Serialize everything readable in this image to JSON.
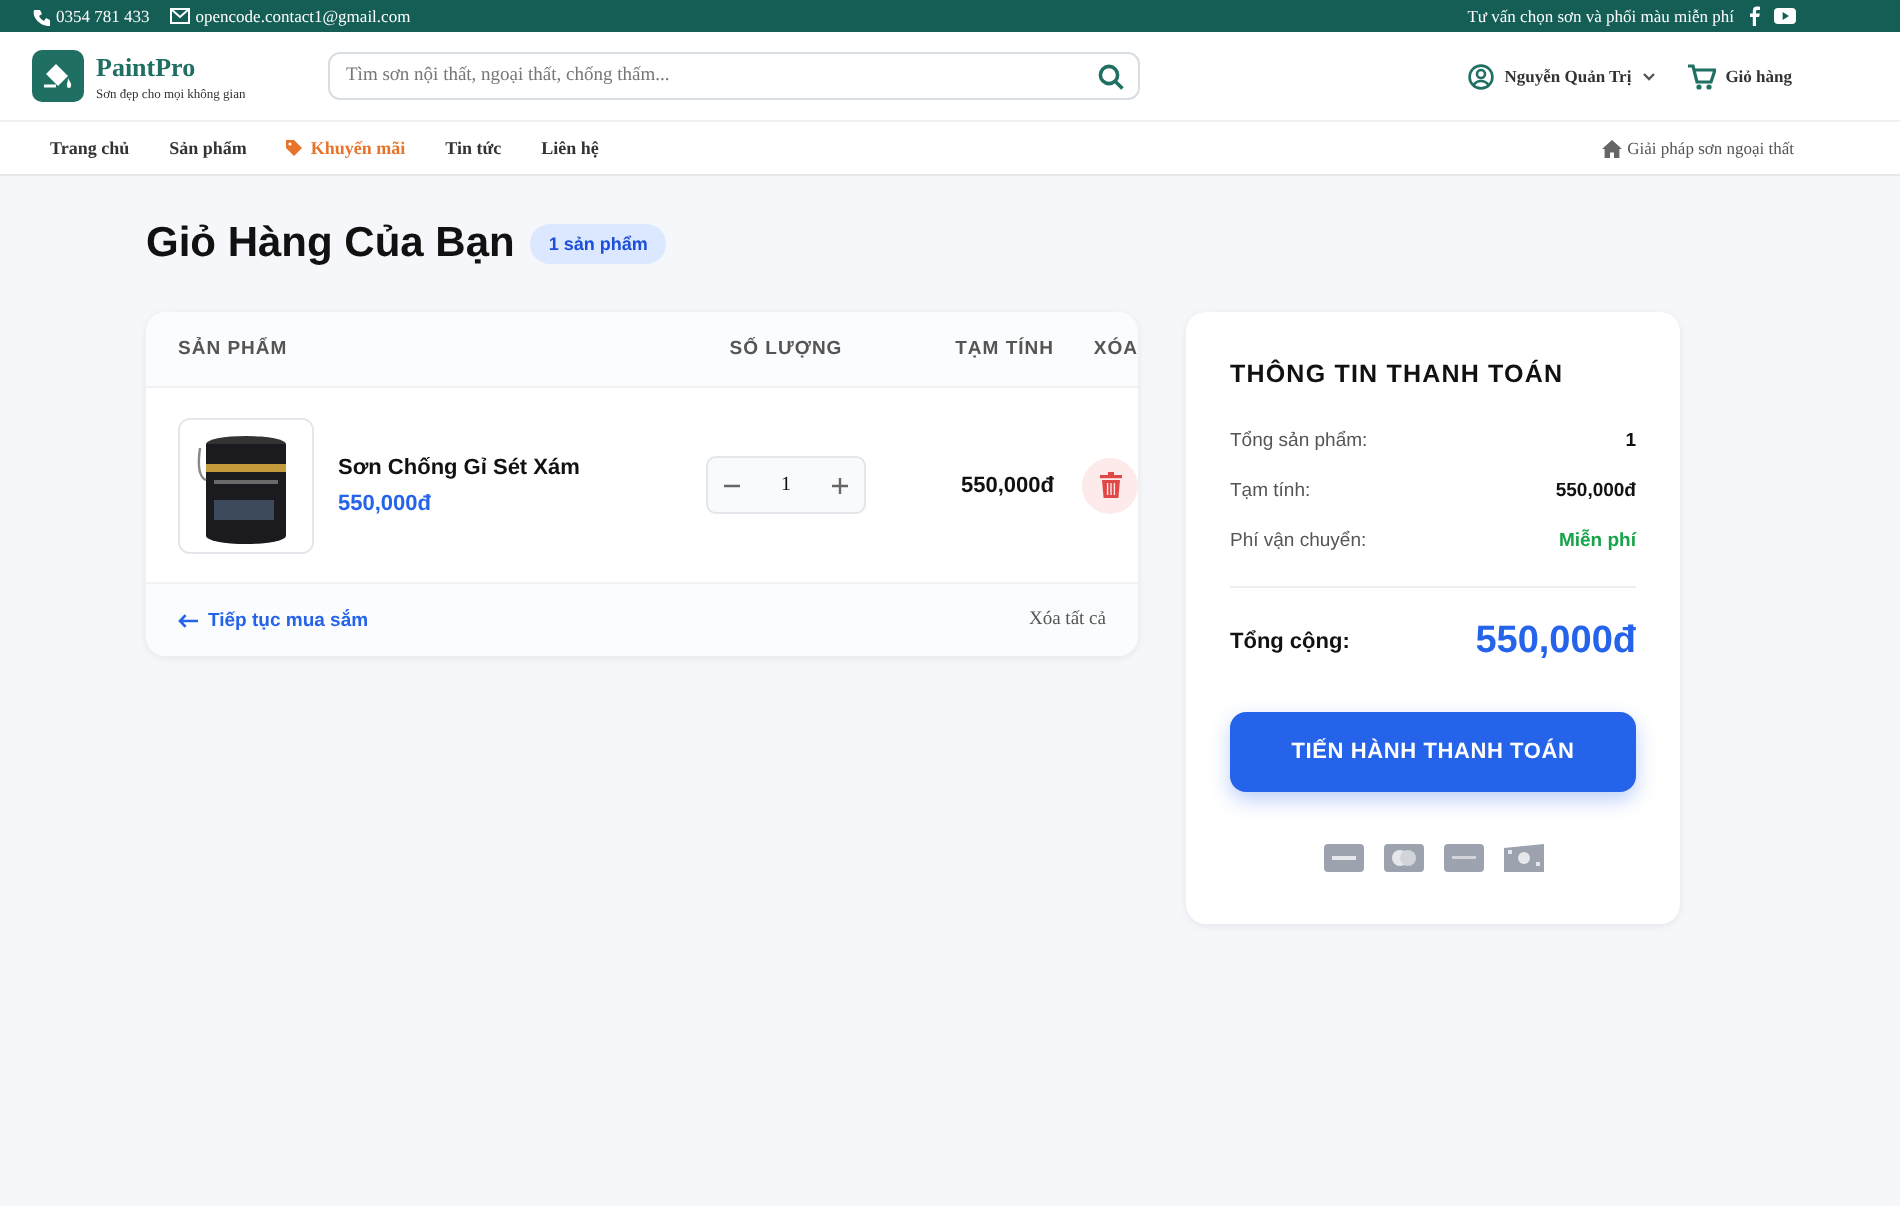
{
  "topbar": {
    "phone": "0354 781 433",
    "email": "opencode.contact1@gmail.com",
    "promo_text": "Tư vấn chọn sơn và phối màu miễn phí"
  },
  "header": {
    "brand": "PaintPro",
    "tagline": "Sơn đẹp cho mọi không gian",
    "search": {
      "placeholder": "Tìm sơn nội thất, ngoại thất, chống thấm..."
    },
    "user": "Nguyễn Quản Trị",
    "cart": "Giỏ hàng"
  },
  "nav": {
    "items": [
      {
        "label": "Trang chủ",
        "kind": "link"
      },
      {
        "label": "Sản phẩm",
        "kind": "link"
      },
      {
        "label": "Khuyến mãi",
        "kind": "promo"
      },
      {
        "label": "Tin tức",
        "kind": "link"
      },
      {
        "label": "Liên hệ",
        "kind": "link"
      }
    ],
    "right_link": "Giải pháp sơn ngoại thất"
  },
  "page": {
    "title": "Giỏ Hàng Của Bạn",
    "count_badge": "1 sản phẩm"
  },
  "cart": {
    "columns": [
      "SẢN PHẨM",
      "SỐ LƯỢNG",
      "TẠM TÍNH",
      "XÓA"
    ],
    "items": [
      {
        "name": "Sơn Chống Gỉ Sét Xám",
        "price": "550,000đ",
        "quantity": "1",
        "subtotal": "550,000đ"
      }
    ],
    "continue_link": "Tiếp tục mua sắm",
    "clear_all": "Xóa tất cả"
  },
  "summary": {
    "title": "THÔNG TIN THANH TOÁN",
    "rows": [
      {
        "label": "Tổng sản phẩm:",
        "value": "1",
        "kind": "plain"
      },
      {
        "label": "Tạm tính:",
        "value": "550,000đ",
        "kind": "plain"
      },
      {
        "label": "Phí vận chuyển:",
        "value": "Miễn phí",
        "kind": "free"
      }
    ],
    "total_label": "Tổng cộng:",
    "total_value": "550,000đ",
    "checkout_button": "TIẾN HÀNH THANH TOÁN"
  }
}
